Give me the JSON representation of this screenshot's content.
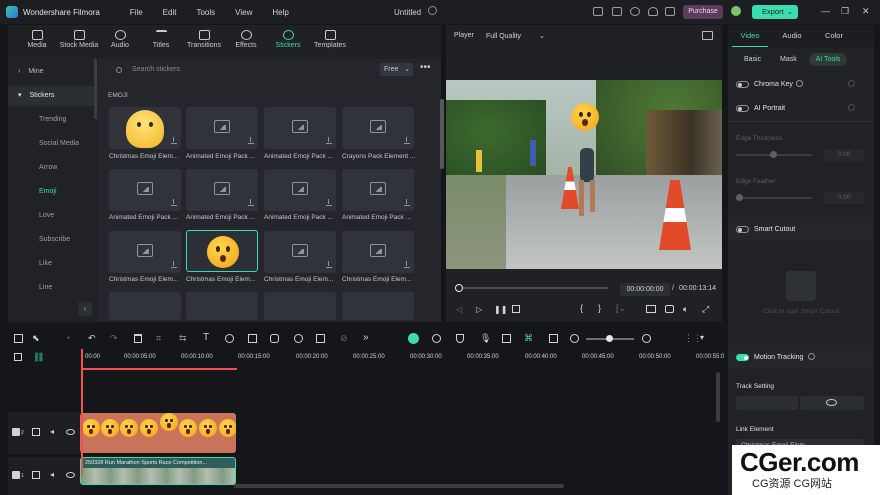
{
  "titlebar": {
    "app_name": "Wondershare Filmora",
    "menu": [
      "File",
      "Edit",
      "Tools",
      "View",
      "Help"
    ],
    "doc_title": "Untitled",
    "purchase": "Purchase",
    "export": "Export"
  },
  "media_tabs": [
    "Media",
    "Stock Media",
    "Audio",
    "Titles",
    "Transitions",
    "Effects",
    "Stickers",
    "Templates"
  ],
  "active_media_tab": "Stickers",
  "categories": {
    "mine": "Mine",
    "stickers": "Stickers",
    "items": [
      "Trending",
      "Social Media",
      "Arrow",
      "Emoji",
      "Love",
      "Subscribe",
      "Like",
      "Line"
    ],
    "active": "Emoji"
  },
  "search": {
    "placeholder": "Search stickers",
    "filter": "Free"
  },
  "section_label": "EMOJI",
  "stickers": [
    "Christmas Emoji Elem...",
    "Animated Emoji Pack ...",
    "Animated Emoji Pack ...",
    "Crayons Pack Element ...",
    "Animated Emoji Pack ...",
    "Animated Emoji Pack ...",
    "Animated Emoji Pack ...",
    "Animated Emoji Pack ...",
    "Christmas Emoji Elem...",
    "Christmas Emoji Elem...",
    "Christmas Emoji Elem...",
    "Christmas Emoji Elem..."
  ],
  "player": {
    "label": "Player",
    "quality": "Full Quality",
    "current_time": "00:00:00:00",
    "separator": "/",
    "total_time": "00:00:13:14"
  },
  "right_panel": {
    "tabs": [
      "Video",
      "Audio",
      "Color"
    ],
    "subtabs": [
      "Basic",
      "Mask",
      "AI Tools"
    ],
    "chroma_key": "Chroma Key",
    "ai_portrait": "AI Portrait",
    "edge_thickness": "Edge Thickness",
    "edge_thickness_val": "0.00",
    "edge_feather": "Edge Feather",
    "edge_feather_val": "0.00",
    "smart_cutout": "Smart Cutout",
    "smart_cutout_hint": "Click to start Smart Cutout",
    "motion_tracking": "Motion Tracking",
    "track_setting": "Track Setting",
    "link_element": "Link Element",
    "link_value": "Christmas Emoji Elem..."
  },
  "timeline": {
    "ruler": [
      "00:00",
      "00:00:05:00",
      "00:00:10:00",
      "00:00:15:00",
      "00:00:20:00",
      "00:00:25:00",
      "00:00:30:00",
      "00:00:35:00",
      "00:00:40:00",
      "00:00:45:00",
      "00:00:50:00",
      "00:00:55:0"
    ],
    "track2_label": "2",
    "track1_label": "1",
    "video_clip_name": "250328 Run Marathon Sports Race Competition..."
  },
  "watermark": {
    "main": "CGer.com",
    "sub": "CG资源 CG网站"
  },
  "colors": {
    "accent": "#3ddbb0",
    "purchase": "#5a3c5c",
    "clip_sticker": "#c9735a",
    "playhead": "#f05050"
  }
}
